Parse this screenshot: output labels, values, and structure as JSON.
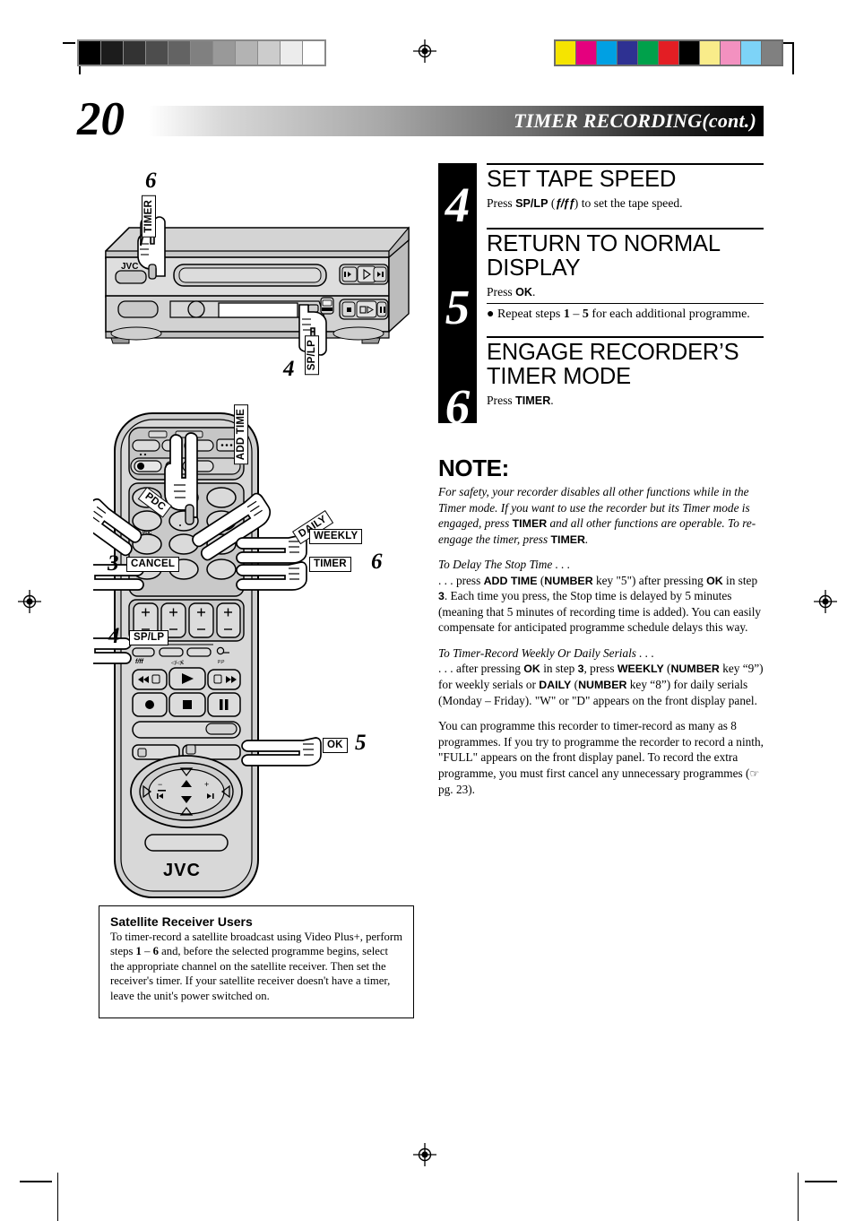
{
  "header": {
    "page_number": "20",
    "title": "TIMER RECORDING(cont.)"
  },
  "calibration": {
    "gray_wedge": [
      "#000000",
      "#1c1c1c",
      "#333333",
      "#4d4d4d",
      "#636363",
      "#808080",
      "#999999",
      "#b3b3b3",
      "#cccccc",
      "#ececec",
      "#ffffff"
    ],
    "color_bar": [
      "#f5e400",
      "#e5007e",
      "#00a0e3",
      "#2e3192",
      "#00a14b",
      "#e31e24",
      "#000000",
      "#f9ec8a",
      "#f391c0",
      "#7dd3f7",
      "#808080"
    ]
  },
  "steps": [
    {
      "number": "4",
      "title": "SET TAPE SPEED",
      "instruction_prefix": "Press ",
      "instruction_key": "SP/LP",
      "instruction_mid": " (",
      "instruction_glyph": "ƒ/ƒƒ",
      "instruction_suffix": ") to set the tape speed."
    },
    {
      "number": "5",
      "title": "RETURN TO NORMAL DISPLAY",
      "instruction_prefix": "Press ",
      "instruction_key": "OK",
      "instruction_suffix": ".",
      "bullet": "● Repeat steps 1 – 5 for each additional programme."
    },
    {
      "number": "6",
      "title": "ENGAGE RECORDER’S TIMER MODE",
      "instruction_prefix": "Press ",
      "instruction_key": "TIMER",
      "instruction_suffix": "."
    }
  ],
  "note": {
    "heading": "NOTE:",
    "paragraph1": "For safety, your recorder disables all other functions while in the Timer mode. If you want to use the recorder but its Timer mode is engaged, press TIMER and all other functions are operable. To re-engage the timer, press TIMER.",
    "sub1": "To Delay The Stop Time . . .",
    "paragraph2": ". . . press ADD TIME (NUMBER key \"5\") after pressing OK in step 3. Each time you press, the Stop time is delayed by 5 minutes (meaning that 5 minutes of recording time is added). You can easily compensate for anticipated programme schedule delays this way.",
    "sub2": "To Timer-Record Weekly Or Daily Serials . . .",
    "paragraph3": ". . . after pressing OK in step 3, press WEEKLY (NUMBER key “9”) for weekly serials or DAILY (NUMBER key “8”) for daily serials (Monday – Friday). \"W\" or \"D\" appears on the front display panel.",
    "paragraph4": "You can programme this recorder to timer-record as many as 8 programmes. If you try to programme the recorder to record a ninth, \"FULL\" appears on the front display panel. To record the extra programme, you must first cancel any unnecessary programmes (☞ pg. 23)."
  },
  "vcr_illustration": {
    "brand": "JVC",
    "callouts": [
      {
        "label": "TIMER",
        "step": "6"
      },
      {
        "label": "SP/LP",
        "step": "4"
      }
    ]
  },
  "remote_illustration": {
    "brand": "JVC",
    "callouts": [
      {
        "label": "ADD TIME",
        "step": ""
      },
      {
        "label": "PDC",
        "step": ""
      },
      {
        "label": "DAILY",
        "step": ""
      },
      {
        "label": "WEEKLY",
        "step": ""
      },
      {
        "label": "TIMER",
        "step": "6"
      },
      {
        "label": "CANCEL",
        "step": "3"
      },
      {
        "label": "SP/LP",
        "step": "4"
      },
      {
        "label": "OK",
        "step": "5"
      }
    ]
  },
  "satellite_box": {
    "heading": "Satellite Receiver Users",
    "body": "To timer-record a satellite broadcast using Video Plus+, perform steps 1 – 6 and, before the selected programme begins, select the appropriate channel on the satellite receiver. Then set the receiver's timer. If your satellite receiver doesn't have a timer, leave the unit's power switched on."
  }
}
